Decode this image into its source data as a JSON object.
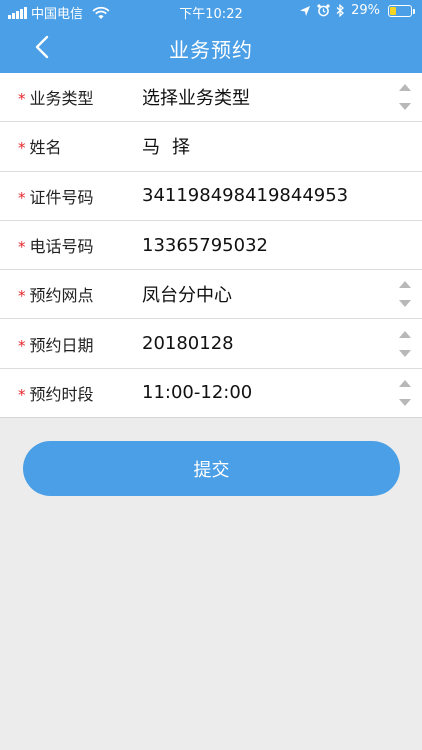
{
  "status_bar": {
    "carrier": "中国电信",
    "time": "下午10:22",
    "battery": "29%",
    "battery_level": 0.29
  },
  "header": {
    "title": "业务预约",
    "back_icon": "chevron-left-icon"
  },
  "form": {
    "required_mark": "*",
    "fields": [
      {
        "label": "业务类型",
        "value": "选择业务类型",
        "has_picker": true
      },
      {
        "label": "姓名",
        "value": "马择",
        "has_picker": false
      },
      {
        "label": "证件号码",
        "value": "341198498419844953",
        "has_picker": false
      },
      {
        "label": "电话号码",
        "value": "13365795032",
        "has_picker": false
      },
      {
        "label": "预约网点",
        "value": "凤台分中心",
        "has_picker": true
      },
      {
        "label": "预约日期",
        "value": "20180128",
        "has_picker": true
      },
      {
        "label": "预约时段",
        "value": "11:00-12:00",
        "has_picker": true
      }
    ]
  },
  "actions": {
    "submit_label": "提交"
  },
  "colors": {
    "primary": "#4a9fe6",
    "required": "#e5262b",
    "background": "#ececec"
  }
}
